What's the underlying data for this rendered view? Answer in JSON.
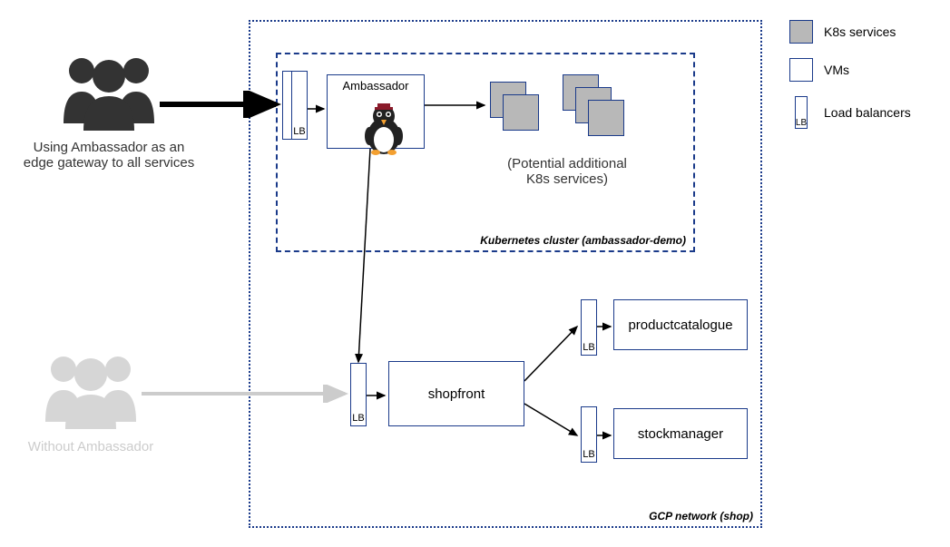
{
  "user_groups": {
    "with_ambassador": {
      "label": "Using Ambassador as an\nedge gateway to all services",
      "color": "#333333"
    },
    "without_ambassador": {
      "label": "Without Ambassador",
      "color": "#cccccc"
    }
  },
  "gcp": {
    "label": "GCP network (shop)"
  },
  "k8s": {
    "label": "Kubernetes cluster (ambassador-demo)"
  },
  "ambassador_box": {
    "label": "Ambassador"
  },
  "potential_services": {
    "label": "(Potential additional\nK8s services)"
  },
  "lb_label": "LB",
  "vms": {
    "shopfront": "shopfront",
    "productcatalogue": "productcatalogue",
    "stockmanager": "stockmanager"
  },
  "legend": {
    "k8s": "K8s services",
    "vms": "VMs",
    "lb": "Load balancers"
  }
}
